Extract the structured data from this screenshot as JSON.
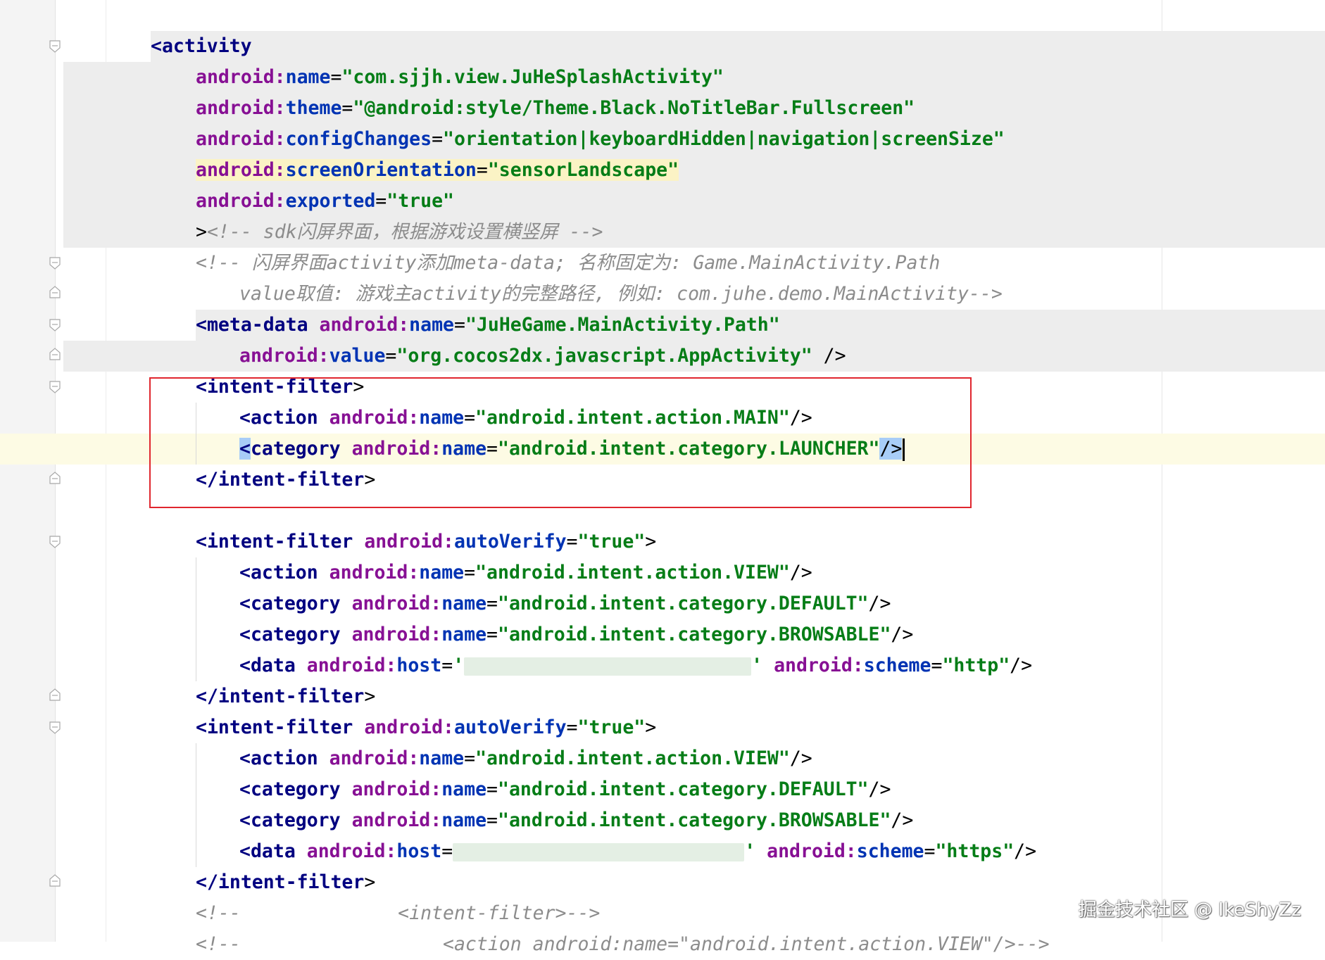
{
  "editor": {
    "lines": {
      "l1": {
        "tag_open": "<activity"
      },
      "l2": {
        "ns": "android:",
        "attr": "name",
        "eq": "=",
        "value": "\"com.sjjh.view.JuHeSplashActivity\""
      },
      "l3": {
        "ns": "android:",
        "attr": "theme",
        "eq": "=",
        "value": "\"@android:style/Theme.Black.NoTitleBar.Fullscreen\""
      },
      "l4": {
        "ns": "android:",
        "attr": "configChanges",
        "eq": "=",
        "value": "\"orientation|keyboardHidden|navigation|screenSize\""
      },
      "l5": {
        "ns": "android:",
        "attr": "screenOrientation",
        "eq": "=",
        "value": "\"sensorLandscape\""
      },
      "l6": {
        "ns": "android:",
        "attr": "exported",
        "eq": "=",
        "value": "\"true\""
      },
      "l7": {
        "close": ">",
        "comment": "<!-- sdk闪屏界面，根据游戏设置横竖屏 -->"
      },
      "l8": {
        "comment": "<!-- 闪屏界面activity添加meta-data; 名称固定为: Game.MainActivity.Path"
      },
      "l9": {
        "comment": "value取值: 游戏主activity的完整路径, 例如: com.juhe.demo.MainActivity-->"
      },
      "l10": {
        "tag": "<meta-data",
        "ns": "android:",
        "attr": "name",
        "eq": "=",
        "value": "\"JuHeGame.MainActivity.Path\""
      },
      "l11": {
        "ns": "android:",
        "attr": "value",
        "eq": "=",
        "value": "\"org.cocos2dx.javascript.AppActivity\"",
        "end": " />"
      },
      "l12": {
        "tag": "<intent-filter",
        "end": ">"
      },
      "l13": {
        "tag": "<action",
        "ns": "android:",
        "attr": "name",
        "eq": "=",
        "value": "\"android.intent.action.MAIN\"",
        "end": "/>"
      },
      "l14": {
        "lt": "<",
        "tag": "category",
        "ns": "android:",
        "attr": "name",
        "eq": "=",
        "value": "\"android.intent.category.LAUNCHER\"",
        "end": "/>"
      },
      "l15": {
        "tag": "</intent-filter",
        "end": ">"
      },
      "l17": {
        "tag": "<intent-filter",
        "ns": "android:",
        "attr": "autoVerify",
        "eq": "=",
        "value": "\"true\"",
        "end": ">"
      },
      "l18": {
        "tag": "<action",
        "ns": "android:",
        "attr": "name",
        "eq": "=",
        "value": "\"android.intent.action.VIEW\"",
        "end": "/>"
      },
      "l19": {
        "tag": "<category",
        "ns": "android:",
        "attr": "name",
        "eq": "=",
        "value": "\"android.intent.category.DEFAULT\"",
        "end": "/>"
      },
      "l20": {
        "tag": "<category",
        "ns": "android:",
        "attr": "name",
        "eq": "=",
        "value": "\"android.intent.category.BROWSABLE\"",
        "end": "/>"
      },
      "l21": {
        "tag": "<data",
        "ns": "android:",
        "attr": "host",
        "eq": "=",
        "value_start": "'",
        "value_end": "'",
        "ns2": "android:",
        "attr2": "scheme",
        "eq2": "=",
        "value2": "\"http\"",
        "end": "/>"
      },
      "l22": {
        "tag": "</intent-filter",
        "end": ">"
      },
      "l23": {
        "tag": "<intent-filter",
        "ns": "android:",
        "attr": "autoVerify",
        "eq": "=",
        "value": "\"true\"",
        "end": ">"
      },
      "l24": {
        "tag": "<action",
        "ns": "android:",
        "attr": "name",
        "eq": "=",
        "value": "\"android.intent.action.VIEW\"",
        "end": "/>"
      },
      "l25": {
        "tag": "<category",
        "ns": "android:",
        "attr": "name",
        "eq": "=",
        "value": "\"android.intent.category.DEFAULT\"",
        "end": "/>"
      },
      "l26": {
        "tag": "<category",
        "ns": "android:",
        "attr": "name",
        "eq": "=",
        "value": "\"android.intent.category.BROWSABLE\"",
        "end": "/>"
      },
      "l27": {
        "tag": "<data",
        "ns": "android:",
        "attr": "host",
        "eq": "=",
        "value_end": "'",
        "ns2": "android:",
        "attr2": "scheme",
        "eq2": "=",
        "value2": "\"https\"",
        "end": "/>"
      },
      "l28": {
        "tag": "</intent-filter",
        "end": ">"
      },
      "l29": {
        "comment": "<!--              <intent-filter>-->"
      },
      "l30": {
        "comment": "<!--                  <action android:name=\"android.intent.action.VIEW\"/>-->"
      }
    }
  },
  "annotation": {
    "color": "#e0262e"
  },
  "watermark": {
    "text": "掘金技术社区 @ IkeShyZz"
  },
  "colors": {
    "tag": "#000080",
    "namespace": "#871094",
    "attribute": "#0033b3",
    "value": "#067d17",
    "comment": "#8c8c8c",
    "current_line": "#fdfbe4",
    "highlight_yellow": "#fbf3c5",
    "highlight_blue": "#a8cdf7"
  },
  "icons": [
    "fold-marker-icon"
  ]
}
